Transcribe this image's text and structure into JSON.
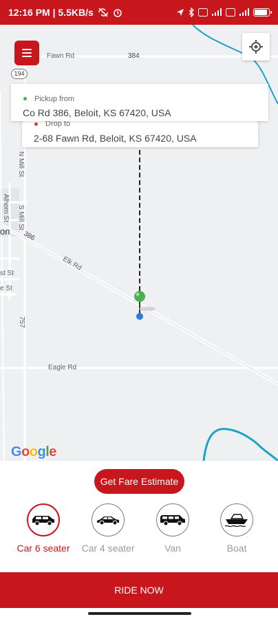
{
  "status_bar": {
    "time_speed": "12:16 PM | 5.5KB/s",
    "battery_level": 0.8
  },
  "map": {
    "labels": {
      "fawn_rd": "Fawn Rd",
      "road_384": "384",
      "route_194": "194",
      "n_mill_st": "N Mill St",
      "alhorn_st": "Alhorn St",
      "s_mill_st": "S Mill St",
      "road_386": "386",
      "elk_rd": "Elk Rd",
      "st_1": "st St",
      "st_2": "e St",
      "road_757": "757",
      "on_partial": "on",
      "eagle_rd": "Eagle Rd"
    },
    "pickup": {
      "caption": "Pickup from",
      "address": "Co Rd 386, Beloit, KS 67420, USA"
    },
    "drop": {
      "caption": "Drop to",
      "address": "2-68 Fawn Rd, Beloit, KS 67420, USA"
    },
    "google_logo": "Google"
  },
  "bottom": {
    "fare_button": "Get Fare Estimate",
    "vehicles": [
      {
        "label": "Car 6 seater",
        "icon": "suv-icon",
        "selected": true
      },
      {
        "label": "Car 4 seater",
        "icon": "sedan-icon",
        "selected": false
      },
      {
        "label": "Van",
        "icon": "van-icon",
        "selected": false
      },
      {
        "label": "Boat",
        "icon": "boat-icon",
        "selected": false
      }
    ],
    "ride_now": "RIDE NOW"
  },
  "colors": {
    "brand_red": "#c8161d",
    "pickup_green": "#4caf50",
    "drop_red": "#e53935",
    "water_blue": "#1aa3c8"
  }
}
